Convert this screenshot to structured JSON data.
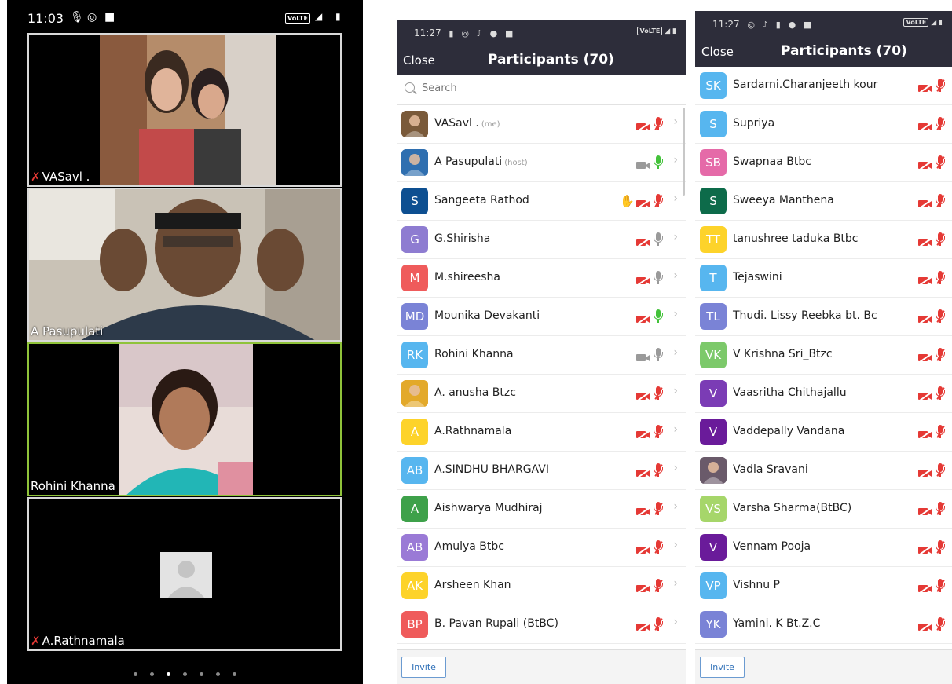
{
  "left_phone": {
    "status_time": "11:03",
    "volte": "VoLTE",
    "tiles": [
      {
        "name": "VASavl .",
        "muted": true
      },
      {
        "name": "A Pasupulati",
        "muted": false
      },
      {
        "name": "Rohini Khanna",
        "muted": false
      },
      {
        "name": "A.Rathnamala",
        "muted": true
      }
    ]
  },
  "panel_middle": {
    "status_time": "11:27",
    "volte": "VoLTE",
    "close_label": "Close",
    "title": "Participants (70)",
    "search_placeholder": "Search",
    "invite_label": "Invite",
    "participants": [
      {
        "initials": "",
        "name": "VASavl .",
        "tag": "(me)",
        "color": "#7a5a3a",
        "photo": true,
        "cam": "off",
        "mic": "off"
      },
      {
        "initials": "",
        "name": "A Pasupulati",
        "tag": "(host)",
        "color": "#2f6fb0",
        "photo": true,
        "cam": "on",
        "mic": "green"
      },
      {
        "initials": "S",
        "name": "Sangeeta Rathod",
        "tag": "",
        "color": "#0d4f91",
        "cam": "off",
        "mic": "off",
        "hand": true
      },
      {
        "initials": "G",
        "name": "G.Shirisha",
        "tag": "",
        "color": "#8e7cd1",
        "cam": "off",
        "mic": "grey"
      },
      {
        "initials": "M",
        "name": "M.shireesha",
        "tag": "",
        "color": "#ef5b5b",
        "cam": "off",
        "mic": "grey"
      },
      {
        "initials": "MD",
        "name": "Mounika Devakanti",
        "tag": "",
        "color": "#7a83d6",
        "cam": "off",
        "mic": "green"
      },
      {
        "initials": "RK",
        "name": "Rohini Khanna",
        "tag": "",
        "color": "#57b6ef",
        "cam": "on",
        "mic": "grey"
      },
      {
        "initials": "",
        "name": "A. anusha Btzc",
        "tag": "",
        "color": "#e3a92a",
        "photo": true,
        "cam": "off",
        "mic": "off"
      },
      {
        "initials": "A",
        "name": "A.Rathnamala",
        "tag": "",
        "color": "#fdd32a",
        "cam": "off",
        "mic": "off"
      },
      {
        "initials": "AB",
        "name": "A.SINDHU BHARGAVI",
        "tag": "",
        "color": "#57b6ef",
        "cam": "off",
        "mic": "off"
      },
      {
        "initials": "A",
        "name": "Aishwarya Mudhiraj",
        "tag": "",
        "color": "#3ea14a",
        "cam": "off",
        "mic": "off"
      },
      {
        "initials": "AB",
        "name": "Amulya Btbc",
        "tag": "",
        "color": "#9a7ad6",
        "cam": "off",
        "mic": "off"
      },
      {
        "initials": "AK",
        "name": "Arsheen Khan",
        "tag": "",
        "color": "#fdd32a",
        "cam": "off",
        "mic": "off"
      },
      {
        "initials": "BP",
        "name": "B. Pavan Rupali (BtBC)",
        "tag": "",
        "color": "#ef5b5b",
        "cam": "off",
        "mic": "off"
      }
    ]
  },
  "panel_right": {
    "status_time": "11:27",
    "volte": "VoLTE",
    "close_label": "Close",
    "title": "Participants (70)",
    "invite_label": "Invite",
    "participants": [
      {
        "initials": "SK",
        "name": "Sardarni.Charanjeeth kour",
        "color": "#57b6ef"
      },
      {
        "initials": "S",
        "name": "Supriya",
        "color": "#57b6ef"
      },
      {
        "initials": "SB",
        "name": "Swapnaa Btbc",
        "color": "#e56aa8"
      },
      {
        "initials": "S",
        "name": "Sweeya Manthena",
        "color": "#0d6b4a"
      },
      {
        "initials": "TT",
        "name": "tanushree taduka Btbc",
        "color": "#fdd32a"
      },
      {
        "initials": "T",
        "name": "Tejaswini",
        "color": "#57b6ef"
      },
      {
        "initials": "TL",
        "name": "Thudi. Lissy Reebka bt. Bc",
        "color": "#7a83d6"
      },
      {
        "initials": "VK",
        "name": "V Krishna Sri_Btzc",
        "color": "#7cc96a"
      },
      {
        "initials": "V",
        "name": "Vaasritha Chithajallu",
        "color": "#7b3cb5"
      },
      {
        "initials": "V",
        "name": "Vaddepally Vandana",
        "color": "#6a1b9a"
      },
      {
        "initials": "",
        "name": "Vadla Sravani",
        "color": "#6a5a6a",
        "photo": true
      },
      {
        "initials": "VS",
        "name": "Varsha Sharma(BtBC)",
        "color": "#a6d66a"
      },
      {
        "initials": "V",
        "name": "Vennam Pooja",
        "color": "#6a1b9a"
      },
      {
        "initials": "VP",
        "name": "Vishnu P",
        "color": "#57b6ef"
      },
      {
        "initials": "YK",
        "name": "Yamini. K Bt.Z.C",
        "color": "#7a83d6"
      }
    ]
  }
}
